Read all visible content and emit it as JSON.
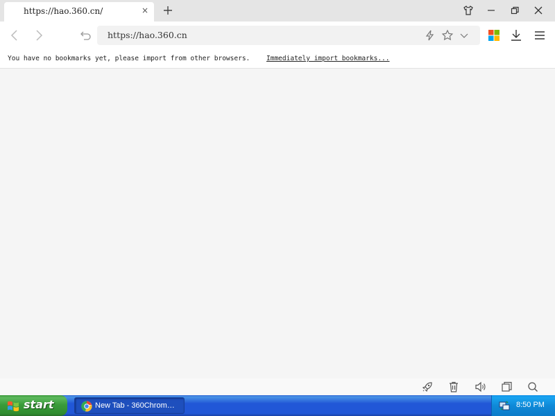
{
  "tab": {
    "title": "https://hao.360.cn/",
    "close_glyph": "×"
  },
  "window_controls": [
    "shirt-skin-icon",
    "minimize-icon",
    "restore-icon",
    "close-icon"
  ],
  "toolbar": {
    "address": "https://hao.360.cn",
    "icons": [
      "back-icon",
      "forward-icon",
      "undo-icon",
      "lightning-icon",
      "star-icon",
      "chevron-down-icon",
      "apps-icon",
      "download-icon",
      "menu-icon"
    ]
  },
  "bookmarks_bar": {
    "message": "You have no bookmarks yet, please import from other browsers.",
    "link": "Immediately import bookmarks..."
  },
  "status_bar": {
    "icons": [
      "rocket-icon",
      "trash-icon",
      "speaker-icon",
      "window-icon",
      "search-icon"
    ]
  },
  "taskbar": {
    "start_label": "start",
    "task_label": "New Tab - 360Chrom…",
    "clock": "8:50 PM"
  },
  "colors": {
    "taskbar_blue": "#2157d7",
    "start_green": "#3a9c3a",
    "tray_blue": "#0f8ad8",
    "content_bg": "#f5f5f5"
  }
}
